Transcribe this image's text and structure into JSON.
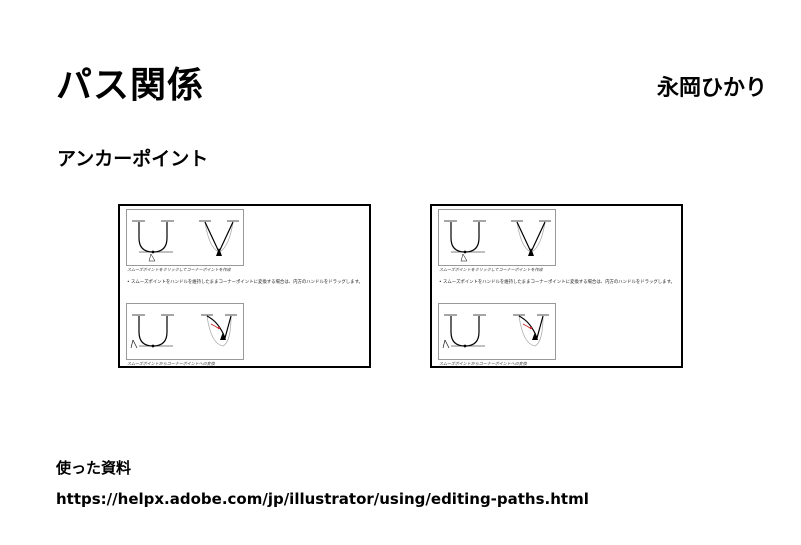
{
  "title": "パス関係",
  "author": "永岡ひかり",
  "section_title": "アンカーポイント",
  "panels": [
    {
      "caption_top": "スムーズポイントをクリックしてコーナーポイントを作成",
      "bullet": "スムーズポイントをハンドルを維持したままコーナーポイントに変換する場合は、内方のハンドルをドラッグします。",
      "caption_bottom": "スムーズポイントからコーナーポイントへの変換"
    },
    {
      "caption_top": "スムーズポイントをクリックしてコーナーポイントを作成",
      "bullet": "スムーズポイントをハンドルを維持したままコーナーポイントに変換する場合は、内方のハンドルをドラッグします。",
      "caption_bottom": "スムーズポイントからコーナーポイントへの変換"
    }
  ],
  "references": {
    "label": "使った資料",
    "url": "https://helpx.adobe.com/jp/illustrator/using/editing-paths.html"
  },
  "colors": {
    "accent_red": "#cc2222",
    "guide_gray": "#aaaaaa"
  }
}
